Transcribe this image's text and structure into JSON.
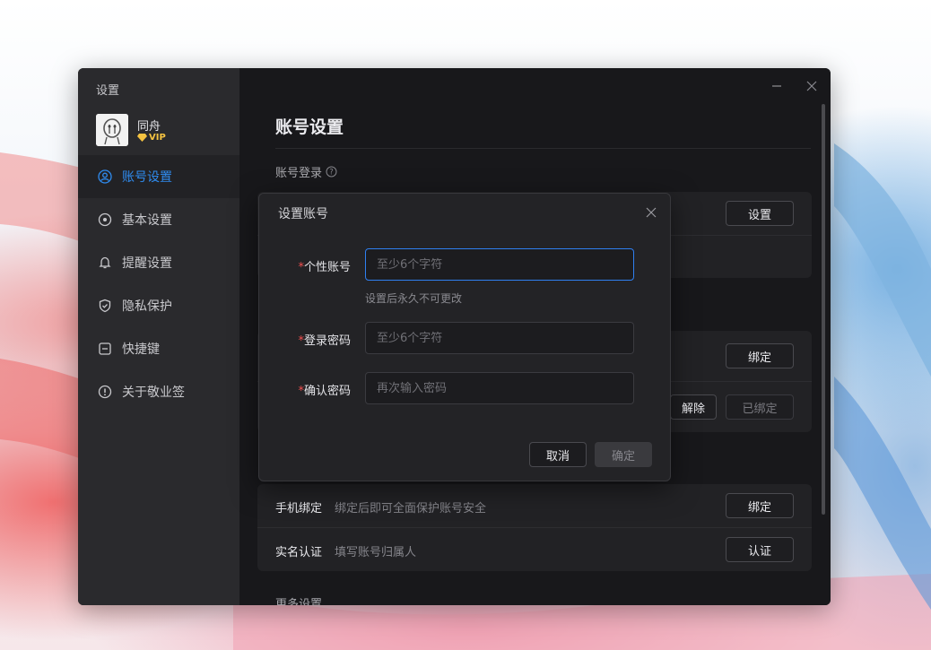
{
  "window": {
    "title": "设置",
    "minimize_icon": "minimize-icon",
    "close_icon": "close-icon"
  },
  "user": {
    "name": "同舟",
    "vip_label": "VIP",
    "vip_color": "#f5c341"
  },
  "sidebar": {
    "items": [
      {
        "label": "账号设置",
        "icon": "user-icon",
        "active": true
      },
      {
        "label": "基本设置",
        "icon": "settings-icon"
      },
      {
        "label": "提醒设置",
        "icon": "bell-icon"
      },
      {
        "label": "隐私保护",
        "icon": "shield-icon"
      },
      {
        "label": "快捷键",
        "icon": "keyboard-icon"
      },
      {
        "label": "关于敬业签",
        "icon": "info-icon"
      }
    ],
    "accent": "#2f8cf0"
  },
  "main": {
    "title": "账号设置",
    "account_login_label": "账号登录",
    "help_icon": "help-icon",
    "set_button": "设置",
    "bind_button": "绑定",
    "unbind_button": "解除",
    "bound_button": "已绑定",
    "phone": {
      "title": "手机绑定",
      "desc": "绑定后即可全面保护账号安全",
      "button": "绑定"
    },
    "realname": {
      "title": "实名认证",
      "desc": "填写账号归属人",
      "button": "认证"
    },
    "more_settings": "更多设置"
  },
  "modal": {
    "title": "设置账号",
    "fields": [
      {
        "required_mark": "*",
        "label": "个性账号",
        "value": "",
        "placeholder": "至少6个字符",
        "hint": "设置后永久不可更改"
      },
      {
        "required_mark": "*",
        "label": "登录密码",
        "value": "",
        "placeholder": "至少6个字符"
      },
      {
        "required_mark": "*",
        "label": "确认密码",
        "value": "",
        "placeholder": "再次输入密码"
      }
    ],
    "cancel": "取消",
    "confirm": "确定",
    "required_color": "#f04f4f"
  }
}
